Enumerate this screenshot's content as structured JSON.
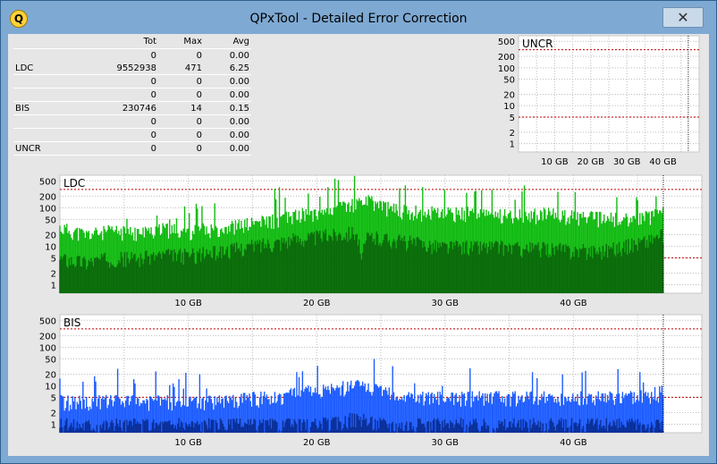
{
  "window": {
    "title": "QPxTool - Detailed Error Correction",
    "icon_letter": "Q",
    "close_glyph": "✕",
    "colors": {
      "frame": "#7ea9d3",
      "client": "#e6e6e6",
      "ldc": "#11bb11",
      "ldc_dark": "#0b6b0b",
      "bis": "#1e5dff",
      "bis_dark": "#0a2f99",
      "threshold": "#c00000"
    }
  },
  "stats": {
    "headers": [
      "",
      "Tot",
      "Max",
      "Avg"
    ],
    "rows": [
      {
        "label": "",
        "tot": "0",
        "max": "0",
        "avg": "0.00"
      },
      {
        "label": "LDC",
        "tot": "9552938",
        "max": "471",
        "avg": "6.25"
      },
      {
        "label": "",
        "tot": "0",
        "max": "0",
        "avg": "0.00"
      },
      {
        "label": "",
        "tot": "0",
        "max": "0",
        "avg": "0.00"
      },
      {
        "label": "BIS",
        "tot": "230746",
        "max": "14",
        "avg": "0.15"
      },
      {
        "label": "",
        "tot": "0",
        "max": "0",
        "avg": "0.00"
      },
      {
        "label": "",
        "tot": "0",
        "max": "0",
        "avg": "0.00"
      },
      {
        "label": "UNCR",
        "tot": "0",
        "max": "0",
        "avg": "0.00"
      }
    ]
  },
  "chart_data": [
    {
      "type": "area",
      "title": "UNCR",
      "y_scale": "log",
      "y_ticks": [
        "500",
        "200",
        "100",
        "50",
        "20",
        "10",
        "5",
        "2",
        "1"
      ],
      "x_ticks": [
        "10 GB",
        "20 GB",
        "30 GB",
        "40 GB"
      ],
      "xlim": [
        0,
        50
      ],
      "ylim": [
        1,
        500
      ],
      "grid": true,
      "end_marker_gb": 47,
      "threshold_lines": [
        300,
        5
      ],
      "series": [
        {
          "values": [
            [
              0,
              0
            ],
            [
              47,
              0
            ]
          ]
        }
      ]
    },
    {
      "type": "area",
      "title": "LDC",
      "y_scale": "log",
      "y_ticks": [
        "500",
        "200",
        "100",
        "50",
        "20",
        "10",
        "5",
        "2",
        "1"
      ],
      "x_ticks": [
        "10 GB",
        "20 GB",
        "30 GB",
        "40 GB"
      ],
      "xlim": [
        0,
        50
      ],
      "ylim": [
        1,
        500
      ],
      "grid": true,
      "end_marker_gb": 47,
      "threshold_lines": [
        300,
        5
      ],
      "series": [
        {
          "values": [
            [
              0,
              30
            ],
            [
              2,
              20
            ],
            [
              4,
              25
            ],
            [
              6,
              22
            ],
            [
              8,
              28
            ],
            [
              10,
              25
            ],
            [
              12,
              30
            ],
            [
              14,
              35
            ],
            [
              16,
              45
            ],
            [
              18,
              60
            ],
            [
              20,
              80
            ],
            [
              22,
              110
            ],
            [
              24,
              150
            ],
            [
              25,
              120
            ],
            [
              26,
              90
            ],
            [
              28,
              80
            ],
            [
              30,
              70
            ],
            [
              32,
              75
            ],
            [
              34,
              70
            ],
            [
              36,
              65
            ],
            [
              38,
              70
            ],
            [
              40,
              60
            ],
            [
              42,
              55
            ],
            [
              44,
              50
            ],
            [
              46,
              60
            ],
            [
              47,
              70
            ]
          ]
        },
        {
          "values": [
            [
              0,
              5
            ],
            [
              2,
              4
            ],
            [
              4,
              5
            ],
            [
              6,
              5
            ],
            [
              8,
              6
            ],
            [
              10,
              6
            ],
            [
              12,
              7
            ],
            [
              14,
              9
            ],
            [
              16,
              12
            ],
            [
              18,
              15
            ],
            [
              20,
              18
            ],
            [
              22,
              22
            ],
            [
              23,
              25
            ],
            [
              23.5,
              3
            ],
            [
              24,
              18
            ],
            [
              26,
              15
            ],
            [
              28,
              12
            ],
            [
              30,
              10
            ],
            [
              32,
              10
            ],
            [
              34,
              10
            ],
            [
              36,
              9
            ],
            [
              38,
              9
            ],
            [
              40,
              8
            ],
            [
              42,
              8
            ],
            [
              44,
              10
            ],
            [
              46,
              15
            ],
            [
              47,
              20
            ]
          ]
        }
      ]
    },
    {
      "type": "area",
      "title": "BIS",
      "y_scale": "log",
      "y_ticks": [
        "500",
        "200",
        "100",
        "50",
        "20",
        "10",
        "5",
        "2",
        "1"
      ],
      "x_ticks": [
        "10 GB",
        "20 GB",
        "30 GB",
        "40 GB"
      ],
      "xlim": [
        0,
        50
      ],
      "ylim": [
        1,
        500
      ],
      "grid": true,
      "end_marker_gb": 47,
      "threshold_lines": [
        300,
        5
      ],
      "series": [
        {
          "values": [
            [
              0,
              4
            ],
            [
              4,
              4
            ],
            [
              8,
              4
            ],
            [
              12,
              4
            ],
            [
              16,
              5
            ],
            [
              18,
              6
            ],
            [
              20,
              7
            ],
            [
              22,
              9
            ],
            [
              23,
              11
            ],
            [
              24,
              9
            ],
            [
              26,
              6
            ],
            [
              28,
              5
            ],
            [
              30,
              5
            ],
            [
              34,
              5
            ],
            [
              38,
              5
            ],
            [
              42,
              5
            ],
            [
              46,
              6
            ],
            [
              47,
              7
            ]
          ]
        },
        {
          "values": [
            [
              0,
              1
            ],
            [
              20,
              1
            ],
            [
              22,
              1.2
            ],
            [
              23,
              1.5
            ],
            [
              24,
              1.2
            ],
            [
              26,
              1
            ],
            [
              47,
              1
            ]
          ]
        }
      ]
    }
  ]
}
